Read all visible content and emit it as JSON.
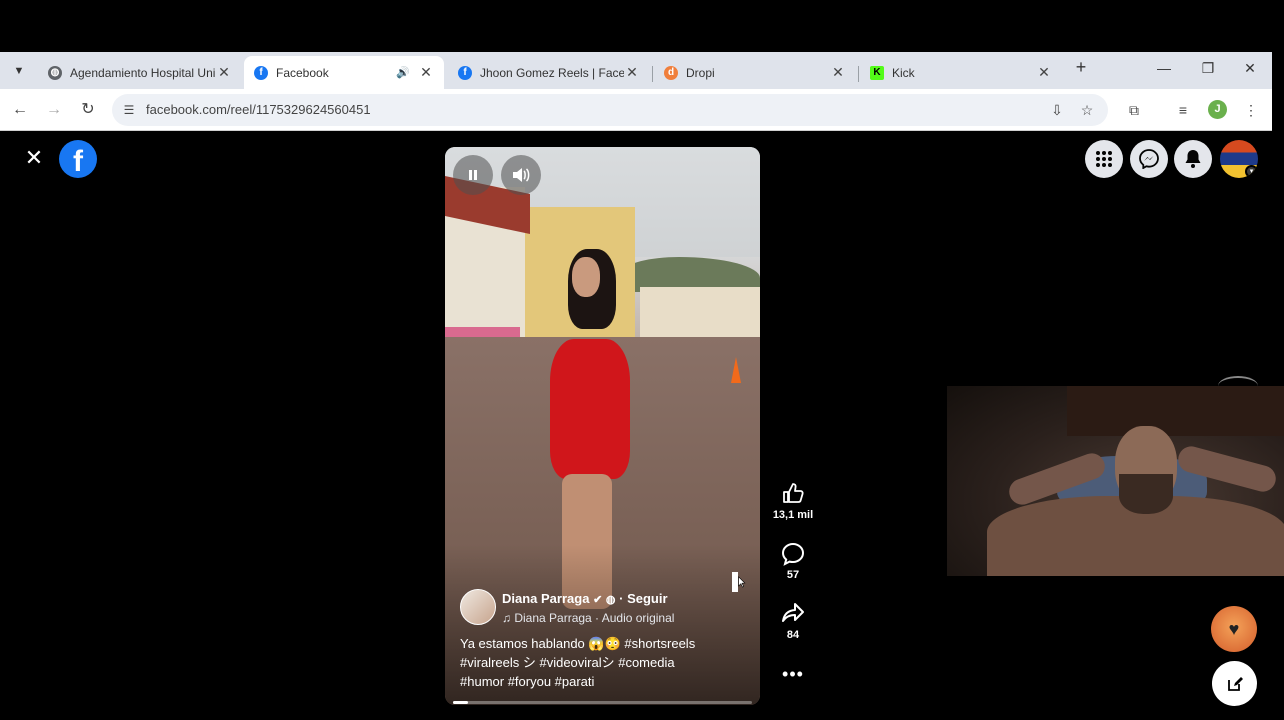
{
  "browser": {
    "tabs": [
      {
        "title": "Agendamiento Hospital Uni",
        "favicon": "globe-icon",
        "active": false
      },
      {
        "title": "Facebook",
        "favicon": "facebook-icon",
        "active": true,
        "audio": true
      },
      {
        "title": "Jhoon Gomez Reels | Facebo",
        "favicon": "facebook-icon",
        "active": false
      },
      {
        "title": "Dropi",
        "favicon": "dropi-icon",
        "active": false
      },
      {
        "title": "Kick",
        "favicon": "kick-icon",
        "active": false
      }
    ],
    "close_glyph": "✕",
    "new_tab_glyph": "+",
    "url": "facebook.com/reel/1175329624560451",
    "profile_initial": "J",
    "colors": {
      "tabbar": "#dfe3eb",
      "toolbar": "#ffffff",
      "omnibox": "#eef1f6"
    }
  },
  "facebook": {
    "logo_letter": "f",
    "brand_color": "#1877f2"
  },
  "reel": {
    "author": "Diana Parraga",
    "verified": true,
    "follow_label": "· Seguir",
    "audio": "Diana Parraga · Audio original",
    "caption_line1": "Ya estamos hablando 😱😳  #shortsreels",
    "caption_line2": "#viralreels シ #videoviralシ #comedia",
    "caption_line3": "#humor #foryou #parati",
    "progress": 0.05
  },
  "actions": {
    "likes": "13,1 mil",
    "comments": "57",
    "shares": "84"
  }
}
